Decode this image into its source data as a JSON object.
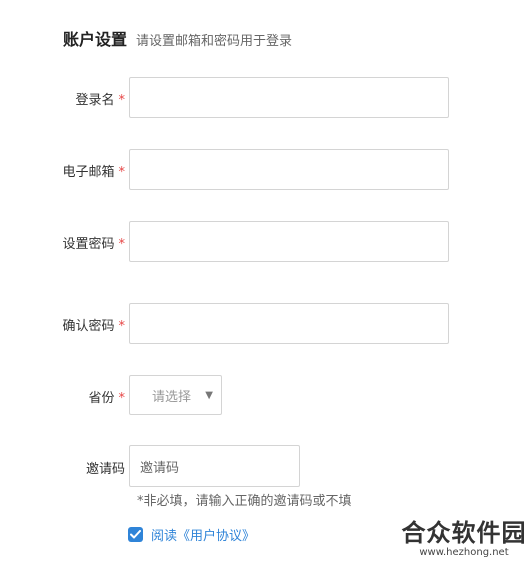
{
  "header": {
    "title": "账户设置",
    "subtitle": "请设置邮箱和密码用于登录"
  },
  "form": {
    "required_mark": "*",
    "login_name": {
      "label": "登录名",
      "value": ""
    },
    "email": {
      "label": "电子邮箱",
      "value": ""
    },
    "password": {
      "label": "设置密码",
      "value": ""
    },
    "confirm_password": {
      "label": "确认密码",
      "value": ""
    },
    "province": {
      "label": "省份",
      "selected": "请选择"
    },
    "invite": {
      "label": "邀请码",
      "placeholder": "邀请码",
      "hint": "*非必填，请输入正确的邀请码或不填"
    },
    "agree": {
      "checked": true,
      "text": "阅读《用户协议》"
    }
  },
  "watermark": {
    "title": "合众软件园",
    "url": "www.hezhong.net"
  },
  "colors": {
    "accent": "#2f84d8",
    "required": "#e64545",
    "border": "#d4d4d4"
  }
}
